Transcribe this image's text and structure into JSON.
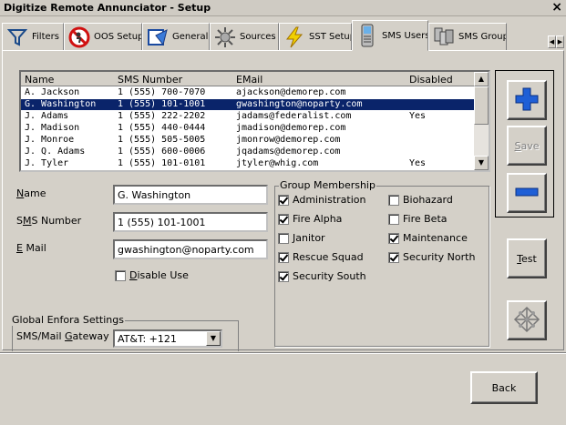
{
  "window": {
    "title": "Digitize Remote Annunciator - Setup",
    "close_glyph": "×"
  },
  "tabs": [
    {
      "label": "Filters",
      "icon": "filter-icon"
    },
    {
      "label": "OOS Setup",
      "icon": "no-entry-icon"
    },
    {
      "label": "General",
      "icon": "general-icon"
    },
    {
      "label": "Sources",
      "icon": "sources-icon"
    },
    {
      "label": "SST Setup",
      "icon": "lightning-icon"
    },
    {
      "label": "SMS Users",
      "icon": "phone-icon",
      "active": true
    },
    {
      "label": "SMS Groups",
      "icon": "groups-icon"
    }
  ],
  "tab_scroll": {
    "left": "◀",
    "right": "▶"
  },
  "users_list": {
    "columns": [
      "Name",
      "SMS Number",
      "EMail",
      "Disabled"
    ],
    "rows": [
      [
        "A. Jackson",
        "1 (555) 700-7070",
        "ajackson@demorep.com",
        ""
      ],
      [
        "G. Washington",
        "1 (555) 101-1001",
        "gwashington@noparty.com",
        ""
      ],
      [
        "J. Adams",
        "1 (555) 222-2202",
        "jadams@federalist.com",
        "Yes"
      ],
      [
        "J. Madison",
        "1 (555) 440-0444",
        "jmadison@demorep.com",
        ""
      ],
      [
        "J. Monroe",
        "1 (555) 505-5005",
        "jmonrow@demorep.com",
        ""
      ],
      [
        "J. Q. Adams",
        "1 (555) 600-0006",
        "jqadams@demorep.com",
        ""
      ],
      [
        "J. Tyler",
        "1 (555) 101-0101",
        "jtyler@whig.com",
        "Yes"
      ]
    ],
    "selected_index": 1,
    "scroll_up": "▲",
    "scroll_down": "▼"
  },
  "form": {
    "name_label_u": "N",
    "name_label_rest": "ame",
    "name_value": "G. Washington",
    "sms_label_pre": "S",
    "sms_label_u": "M",
    "sms_label_rest": "S Number",
    "sms_value": "1 (555) 101-1001",
    "email_label_u": "E",
    "email_label_rest": " Mail",
    "email_value": "gwashington@noparty.com",
    "disable_u": "D",
    "disable_rest": "isable Use",
    "disable_checked": false
  },
  "group_membership": {
    "title": "Group Membership",
    "items": [
      {
        "label": "Administration",
        "checked": true
      },
      {
        "label": "Biohazard",
        "checked": false
      },
      {
        "label": "Fire Alpha",
        "checked": true
      },
      {
        "label": "Fire Beta",
        "checked": false
      },
      {
        "label": "Janitor",
        "checked": false
      },
      {
        "label": "Maintenance",
        "checked": true
      },
      {
        "label": "Rescue Squad",
        "checked": true
      },
      {
        "label": "Security North",
        "checked": true
      },
      {
        "label": "Security South",
        "checked": true
      }
    ]
  },
  "enfora": {
    "title": "Global Enfora Settings",
    "gateway_label_pre": "SMS/Mail ",
    "gateway_label_u": "G",
    "gateway_label_rest": "ateway",
    "gateway_value": "AT&T: +121",
    "arrow": "▼"
  },
  "buttons": {
    "save_u": "S",
    "save_rest": "ave",
    "test_u": "T",
    "test_rest": "est",
    "back": "Back"
  },
  "colors": {
    "add": "#1f5fd6",
    "remove": "#1f5fd6",
    "selection": "#0a246a"
  }
}
